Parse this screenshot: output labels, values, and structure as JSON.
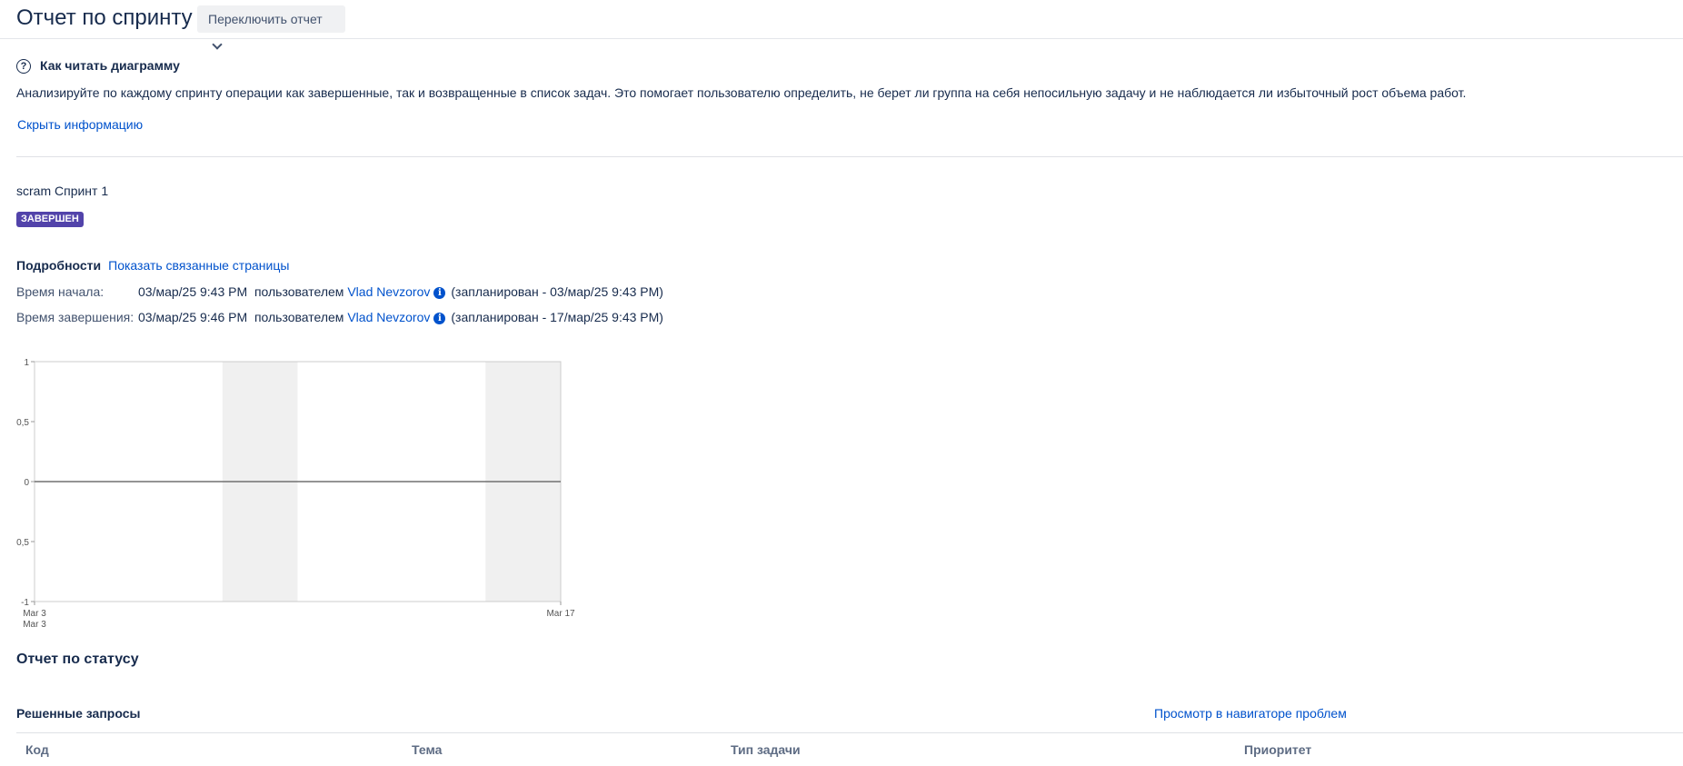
{
  "header": {
    "title": "Отчет по спринту",
    "switch_label": "Переключить отчет"
  },
  "help": {
    "title": "Как читать диаграмму",
    "text": "Анализируйте по каждому спринту операции как завершенные, так и возвращенные в список задач. Это помогает пользователю определить, не берет ли группа на себя непосильную задачу и не наблюдается ли избыточный рост объема работ.",
    "hide_link": "Скрыть информацию"
  },
  "sprint": {
    "name": "scram Спринт 1",
    "status": "ЗАВЕРШЕН",
    "status_color": "#5243aa",
    "details_label": "Подробности",
    "linked_pages_link": "Показать связанные страницы",
    "start": {
      "label": "Время начала:",
      "value": "03/мар/25 9:43 PM",
      "by": "пользователем",
      "user": "Vlad Nevzorov",
      "planned": "(запланирован - 03/мар/25 9:43 PM)"
    },
    "end": {
      "label": "Время завершения:",
      "value": "03/мар/25 9:46 PM",
      "by": "пользователем",
      "user": "Vlad Nevzorov",
      "planned": "(запланирован - 17/мар/25 9:43 PM)"
    }
  },
  "chart_data": {
    "type": "line",
    "title": "",
    "xlabel": "",
    "ylabel": "",
    "ylim": [
      -1,
      1
    ],
    "y_ticks": [
      {
        "value": 1,
        "label": "1"
      },
      {
        "value": 0.5,
        "label": "0,5"
      },
      {
        "value": 0,
        "label": "0"
      },
      {
        "value": -0.5,
        "label": "0,5"
      },
      {
        "value": -1,
        "label": "-1"
      }
    ],
    "x_domain": [
      "2025-03-03",
      "2025-03-17"
    ],
    "x_ticks": [
      {
        "date": "2025-03-03",
        "label": "Mar 3"
      },
      {
        "date": "2025-03-03",
        "label": "Mar 3"
      },
      {
        "date": "2025-03-17",
        "label": "Mar 17"
      }
    ],
    "weekend_bands": [
      [
        "2025-03-08",
        "2025-03-10"
      ],
      [
        "2025-03-15",
        "2025-03-17"
      ]
    ],
    "series": [
      {
        "values": [
          {
            "x": "2025-03-03",
            "y": 0
          },
          {
            "x": "2025-03-17",
            "y": 0
          }
        ]
      }
    ],
    "grid": false
  },
  "status_report": {
    "title": "Отчет по статусу",
    "resolved_title": "Решенные запросы",
    "navigator_link": "Просмотр в навигаторе проблем",
    "columns": [
      "Код",
      "Тема",
      "Тип задачи",
      "Приоритет"
    ]
  }
}
